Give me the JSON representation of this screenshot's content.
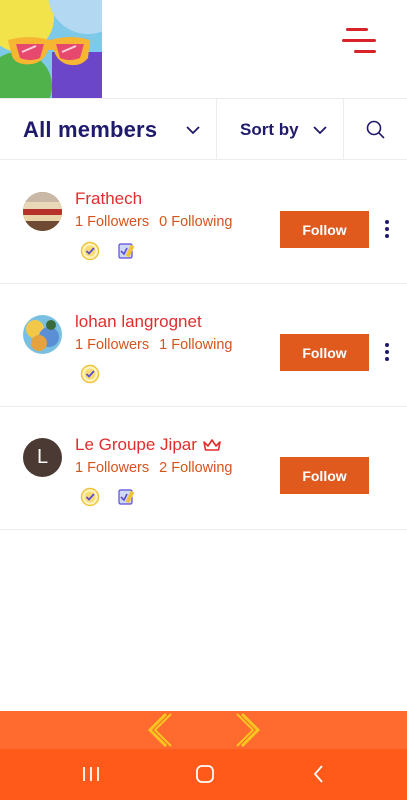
{
  "filters": {
    "all_label": "All members",
    "sort_label": "Sort by"
  },
  "members": [
    {
      "name": "Frathech",
      "followers": "1 Followers",
      "following": "0 Following",
      "follow_label": "Follow",
      "badges": [
        "check-badge-icon",
        "edit-badge-icon"
      ]
    },
    {
      "name": "lohan langrognet",
      "followers": "1 Followers",
      "following": "1 Following",
      "follow_label": "Follow",
      "badges": [
        "check-badge-icon"
      ]
    },
    {
      "name": "Le Groupe Jipar",
      "avatar_letter": "L",
      "followers": "1 Followers",
      "following": "2 Following",
      "follow_label": "Follow",
      "badges": [
        "check-badge-icon",
        "edit-badge-icon"
      ]
    }
  ],
  "colors": {
    "brand_navy": "#1f1a6b",
    "name_red": "#e22d2d",
    "stats_orange": "#d4541e",
    "follow_button": "#e05a1e",
    "ad_bar": "#ff6a2e",
    "nav_bar": "#ff5a1a"
  }
}
